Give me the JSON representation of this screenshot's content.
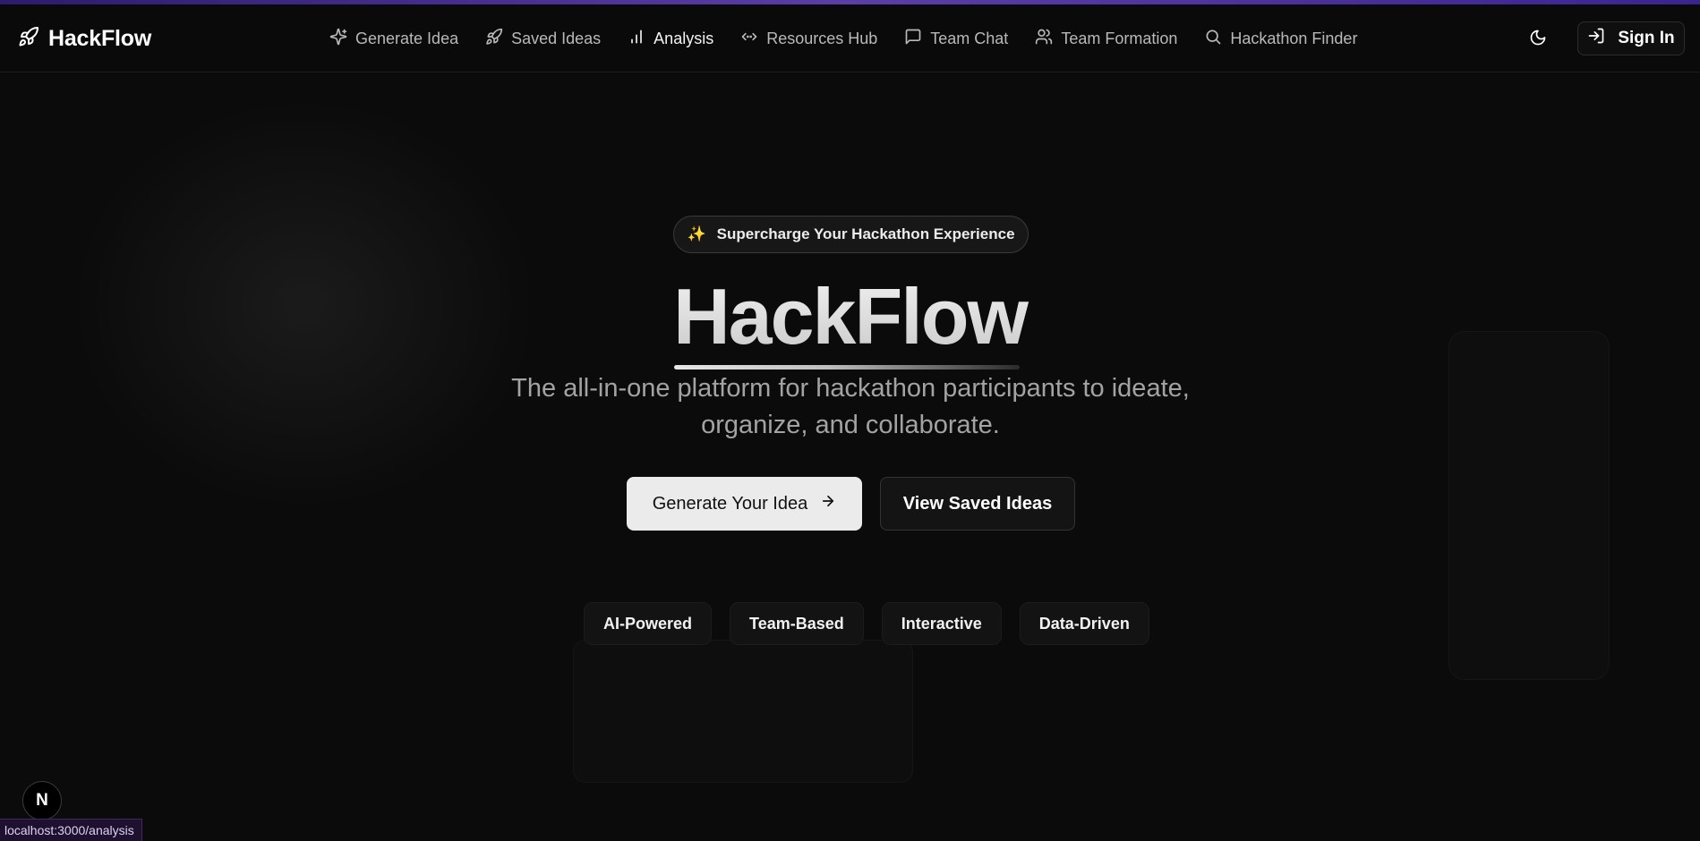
{
  "brand": {
    "name": "HackFlow",
    "logo_icon": "rocket-icon"
  },
  "nav": {
    "items": [
      {
        "label": "Generate Idea",
        "icon": "sparkles-icon",
        "active": false
      },
      {
        "label": "Saved Ideas",
        "icon": "rocket-icon",
        "active": false
      },
      {
        "label": "Analysis",
        "icon": "bar-chart-icon",
        "active": true
      },
      {
        "label": "Resources Hub",
        "icon": "code-icon",
        "active": false
      },
      {
        "label": "Team Chat",
        "icon": "message-square-icon",
        "active": false
      },
      {
        "label": "Team Formation",
        "icon": "users-icon",
        "active": false
      },
      {
        "label": "Hackathon Finder",
        "icon": "search-icon",
        "active": false
      }
    ]
  },
  "header_actions": {
    "theme_icon": "moon-icon",
    "signin_label": "Sign In",
    "signin_icon": "log-in-icon"
  },
  "hero": {
    "badge_emoji": "✨",
    "badge_text": "Supercharge Your Hackathon Experience",
    "title": "HackFlow",
    "subtitle_line1": "The all-in-one platform for hackathon participants to ideate,",
    "subtitle_line2": "organize, and collaborate.",
    "primary_button": "Generate Your Idea",
    "primary_button_icon": "arrow-right-icon",
    "secondary_button": "View Saved Ideas"
  },
  "features": [
    "AI-Powered",
    "Team-Based",
    "Interactive",
    "Data-Driven"
  ],
  "dev": {
    "badge_letter": "N",
    "status_url": "localhost:3000/analysis"
  },
  "colors": {
    "background": "#0b0b0b",
    "accent_bar": "#5b3ea8",
    "primary_button_bg": "#ebebeb",
    "nav_text": "#b9b9b9"
  }
}
